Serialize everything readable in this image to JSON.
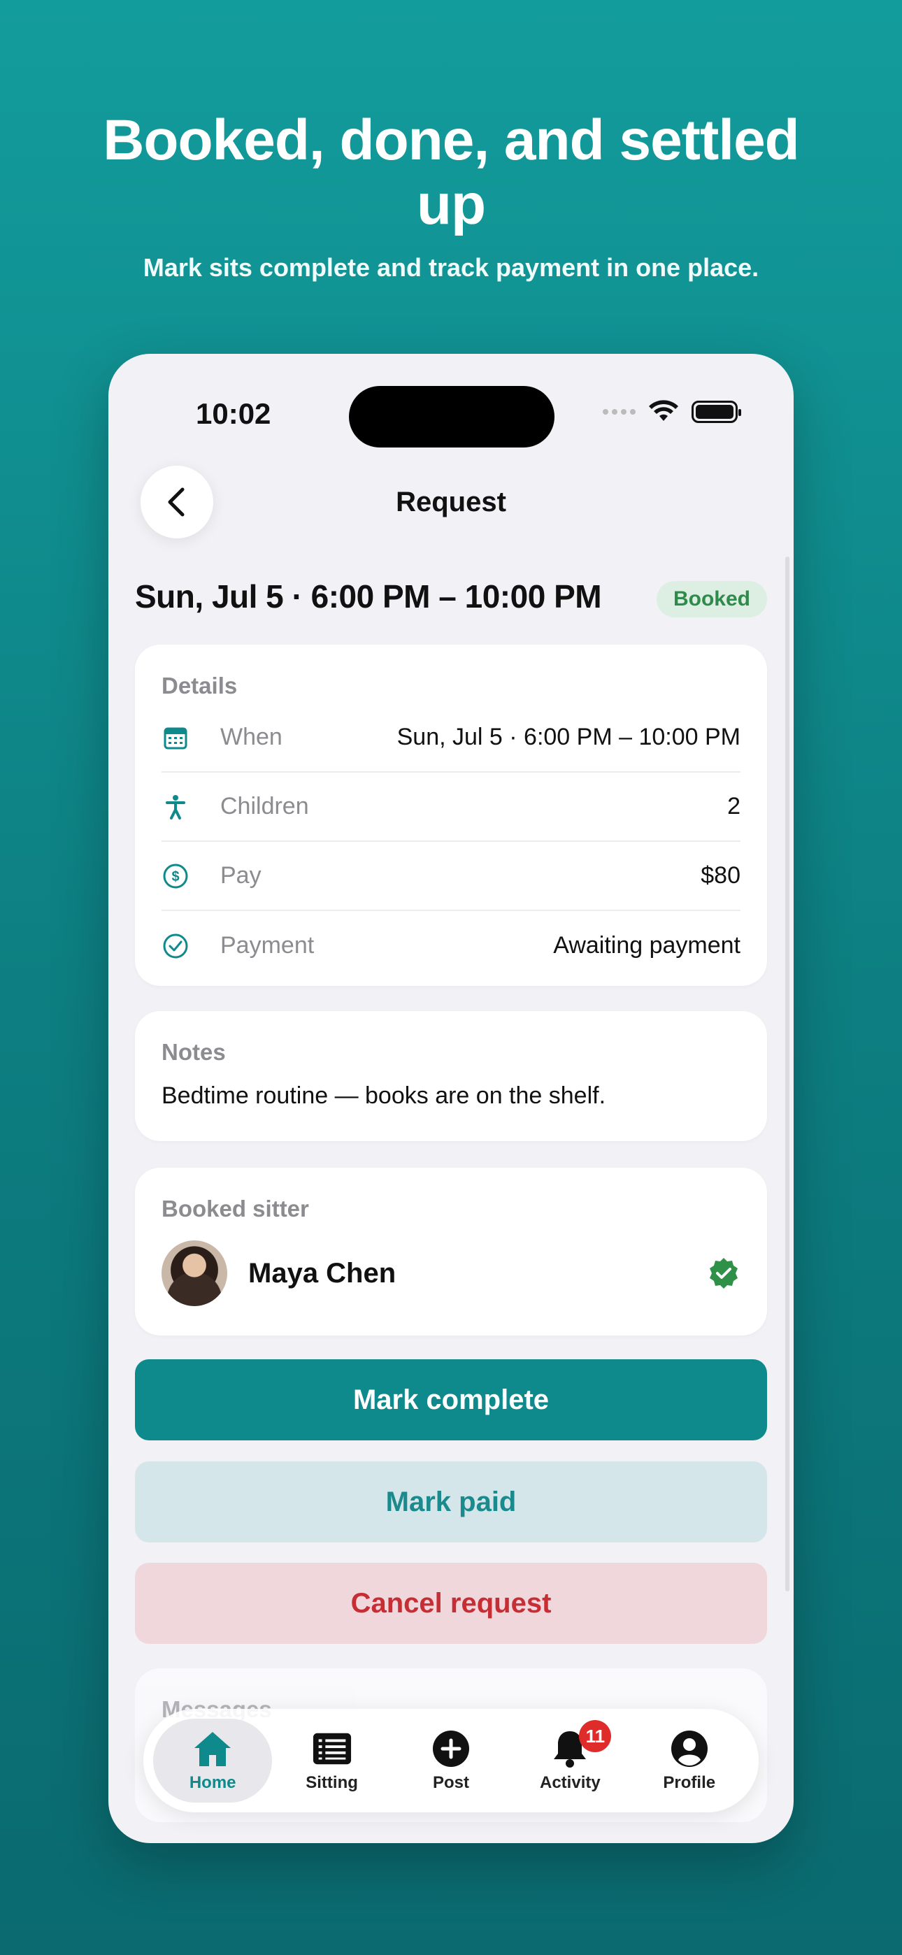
{
  "hero": {
    "title": "Booked, done, and settled up",
    "subtitle": "Mark sits complete and track payment in one place."
  },
  "status_bar": {
    "time": "10:02"
  },
  "nav": {
    "title": "Request",
    "back_icon": "chevron-left-icon"
  },
  "request": {
    "date_header": "Sun, Jul 5 · 6:00 PM – 10:00 PM",
    "status_badge": "Booked",
    "status_color": "#2f8a4b"
  },
  "details": {
    "label": "Details",
    "rows": [
      {
        "name": "When",
        "value": "Sun, Jul 5 · 6:00 PM – 10:00 PM",
        "icon": "calendar-icon"
      },
      {
        "name": "Children",
        "value": "2",
        "icon": "person-icon"
      },
      {
        "name": "Pay",
        "value": "$80",
        "icon": "dollar-circle-icon"
      },
      {
        "name": "Payment",
        "value": "Awaiting payment",
        "icon": "check-circle-icon"
      }
    ]
  },
  "notes": {
    "label": "Notes",
    "text": "Bedtime routine — books are on the shelf."
  },
  "sitter": {
    "label": "Booked sitter",
    "name": "Maya Chen",
    "verified_icon": "verified-badge-icon"
  },
  "actions": {
    "complete": "Mark complete",
    "paid": "Mark paid",
    "cancel": "Cancel request"
  },
  "messages": {
    "label": "Messages"
  },
  "tabbar": {
    "tabs": [
      {
        "label": "Home",
        "icon": "home-icon",
        "active": true
      },
      {
        "label": "Sitting",
        "icon": "list-icon"
      },
      {
        "label": "Post",
        "icon": "plus-circle-icon"
      },
      {
        "label": "Activity",
        "icon": "bell-icon",
        "badge": "11"
      },
      {
        "label": "Profile",
        "icon": "profile-icon"
      }
    ]
  },
  "colors": {
    "accent": "#0e8a8c",
    "background_top": "#139c9c",
    "danger": "#c62e34"
  }
}
